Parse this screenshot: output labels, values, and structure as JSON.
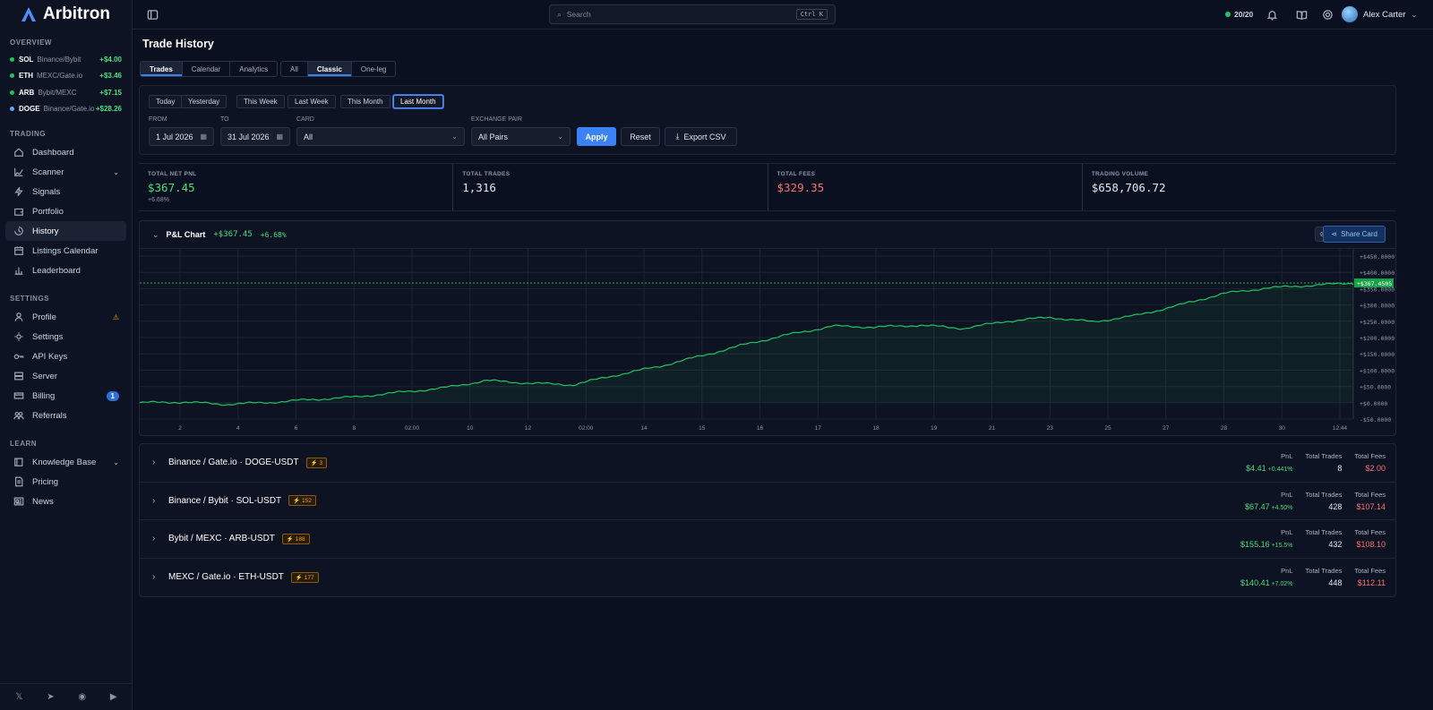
{
  "app": {
    "name": "Arbitron"
  },
  "sidebar": {
    "overview_title": "OVERVIEW",
    "overview": [
      {
        "symbol": "SOL",
        "pair": "Binance/Bybit",
        "pnl": "+$4.00",
        "dot": "#22c55e"
      },
      {
        "symbol": "ETH",
        "pair": "MEXC/Gate.io",
        "pnl": "+$3.46",
        "dot": "#22c55e"
      },
      {
        "symbol": "ARB",
        "pair": "Bybit/MEXC",
        "pnl": "+$7.15",
        "dot": "#22c55e"
      },
      {
        "symbol": "DOGE",
        "pair": "Binance/Gate.io",
        "pnl": "+$28.26",
        "dot": "#60a5fa"
      }
    ],
    "trading_title": "TRADING",
    "trading": [
      {
        "label": "Dashboard",
        "icon": "home-icon"
      },
      {
        "label": "Scanner",
        "icon": "chart-line-icon"
      },
      {
        "label": "Signals",
        "icon": "zap-icon"
      },
      {
        "label": "Portfolio",
        "icon": "wallet-icon"
      },
      {
        "label": "History",
        "icon": "history-icon"
      },
      {
        "label": "Listings Calendar",
        "icon": "calendar-icon"
      },
      {
        "label": "Leaderboard",
        "icon": "bar-chart-icon"
      }
    ],
    "settings_title": "SETTINGS",
    "settings": [
      {
        "label": "Profile",
        "icon": "user-icon"
      },
      {
        "label": "Settings",
        "icon": "gear-icon"
      },
      {
        "label": "API Keys",
        "icon": "key-icon"
      },
      {
        "label": "Server",
        "icon": "server-icon"
      },
      {
        "label": "Billing",
        "icon": "card-icon",
        "badge": "1"
      },
      {
        "label": "Referrals",
        "icon": "users-icon"
      }
    ],
    "learn_title": "LEARN",
    "learn": [
      {
        "label": "Knowledge Base",
        "icon": "book-icon"
      },
      {
        "label": "Pricing",
        "icon": "document-icon"
      },
      {
        "label": "News",
        "icon": "news-icon"
      }
    ]
  },
  "topbar": {
    "search_placeholder": "Search",
    "search_shortcut": "Ctrl K",
    "status": "20/20",
    "user_name": "Alex Carter"
  },
  "page": {
    "title": "Trade History",
    "view_tabs": [
      "Trades",
      "Calendar",
      "Analytics"
    ],
    "mode_tabs": [
      "All",
      "Classic",
      "One-leg"
    ],
    "quick_ranges": [
      "Today",
      "Yesterday",
      "This Week",
      "Last Week",
      "This Month",
      "Last Month"
    ],
    "filters": {
      "from_label": "FROM",
      "from_value": "1 Jul 2026",
      "to_label": "TO",
      "to_value": "31 Jul 2026",
      "card_label": "CARD",
      "card_value": "All",
      "pair_label": "EXCHANGE PAIR",
      "pair_value": "All Pairs",
      "apply": "Apply",
      "reset": "Reset",
      "export": "Export CSV"
    },
    "stats": [
      {
        "label": "TOTAL NET PNL",
        "value": "$367.45",
        "sub": "+6.68%",
        "tone": "green"
      },
      {
        "label": "TOTAL TRADES",
        "value": "1,316",
        "sub": "",
        "tone": ""
      },
      {
        "label": "TOTAL FEES",
        "value": "$329.35",
        "sub": "",
        "tone": "red"
      },
      {
        "label": "TRADING VOLUME",
        "value": "$658,706.72",
        "sub": "",
        "tone": ""
      }
    ],
    "chart_header": {
      "title": "P&L Chart",
      "value": "+$367.45",
      "pct": "+6.68%",
      "share": "Share Card"
    }
  },
  "chart_data": {
    "type": "line",
    "x_ticks": [
      "2",
      "4",
      "6",
      "8",
      "02:00",
      "10",
      "12",
      "02:00",
      "14",
      "15",
      "16",
      "17",
      "18",
      "19",
      "21",
      "23",
      "25",
      "27",
      "28",
      "30",
      "12:44"
    ],
    "y_ticks": [
      "+$450.0000",
      "+$400.0000",
      "+$350.0000",
      "+$300.0000",
      "+$250.0000",
      "+$200.0000",
      "+$150.0000",
      "+$100.0000",
      "+$50.0000",
      "+$0.0000",
      "-$50.0000"
    ],
    "ylim": [
      -50,
      450
    ],
    "current_label": "+$367.4505",
    "current_value": 367.45,
    "values": [
      0,
      2,
      -5,
      1,
      10,
      18,
      32,
      45,
      68,
      60,
      55,
      85,
      112,
      145,
      180,
      210,
      235,
      232,
      238,
      228,
      250,
      262,
      248,
      268,
      300,
      335,
      352,
      360,
      367.45
    ],
    "color": "#22c55e"
  },
  "pairs": [
    {
      "name": "Binance / Gate.io · DOGE-USDT",
      "count": "3",
      "pnl": "$4.41",
      "pct": "+0.441%",
      "trades": "8",
      "fees": "$2.00"
    },
    {
      "name": "Binance / Bybit · SOL-USDT",
      "count": "152",
      "pnl": "$67.47",
      "pct": "+4.50%",
      "trades": "428",
      "fees": "$107.14"
    },
    {
      "name": "Bybit / MEXC · ARB-USDT",
      "count": "188",
      "pnl": "$155.16",
      "pct": "+15.5%",
      "trades": "432",
      "fees": "$108.10"
    },
    {
      "name": "MEXC / Gate.io · ETH-USDT",
      "count": "177",
      "pnl": "$140.41",
      "pct": "+7.02%",
      "trades": "448",
      "fees": "$112.11"
    }
  ],
  "pair_cols": {
    "pnl": "PnL",
    "trades": "Total Trades",
    "fees": "Total Fees"
  }
}
